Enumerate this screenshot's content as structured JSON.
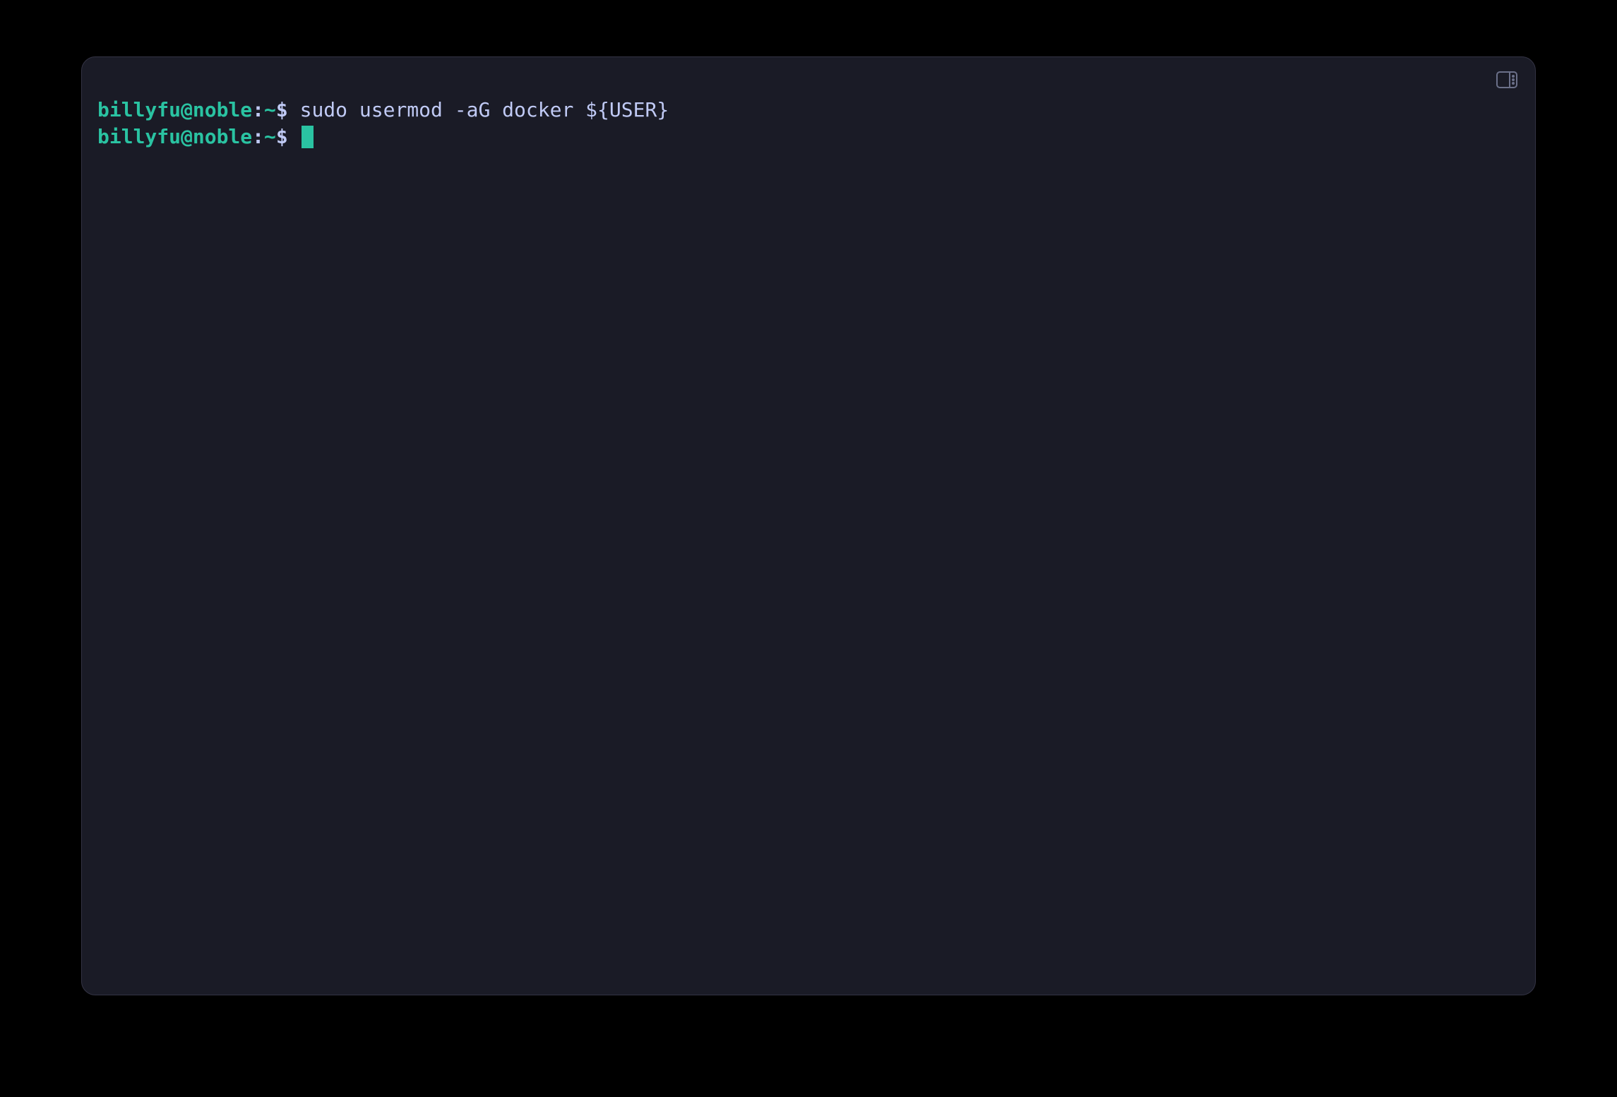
{
  "terminal": {
    "lines": [
      {
        "prompt": {
          "user_host": "billyfu@noble",
          "separator": ":",
          "path": "~",
          "dollar": "$"
        },
        "command": " sudo usermod -aG docker ${USER}"
      },
      {
        "prompt": {
          "user_host": "billyfu@noble",
          "separator": ":",
          "path": "~",
          "dollar": "$"
        },
        "command": " "
      }
    ]
  },
  "colors": {
    "background": "#000000",
    "terminal_bg": "#1a1b26",
    "prompt_green": "#2ac3a2",
    "text": "#c0caf5",
    "border": "#333344"
  }
}
